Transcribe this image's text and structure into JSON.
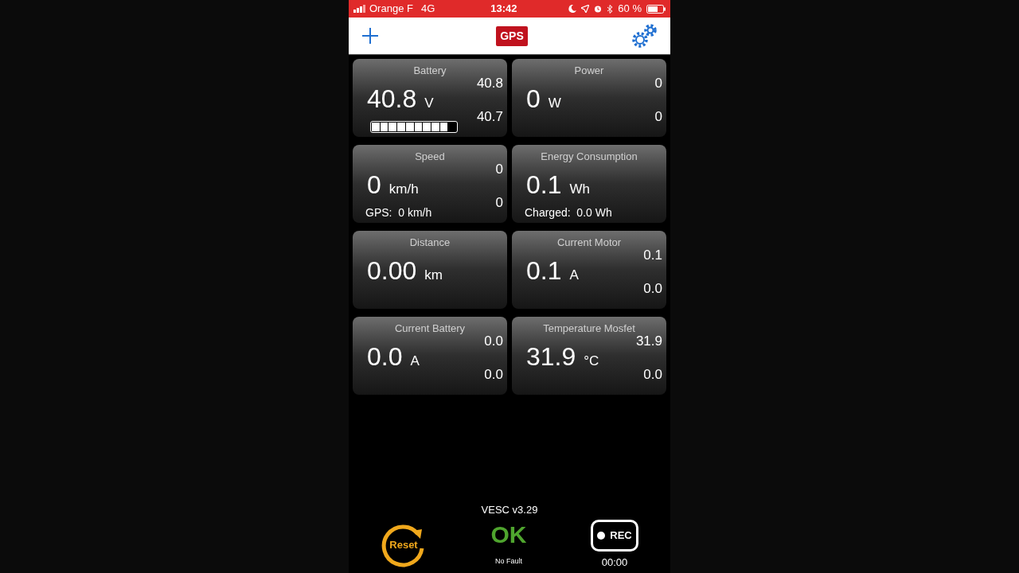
{
  "status_bar": {
    "carrier": "Orange F",
    "network": "4G",
    "time": "13:42",
    "battery": "60 %"
  },
  "header": {
    "badge": "GPS"
  },
  "cards": [
    {
      "kind": "battery",
      "title": "Battery",
      "value": "40.8",
      "unit": "V",
      "max": "40.8",
      "min": "40.7",
      "level": 0.9
    },
    {
      "kind": "plain",
      "title": "Power",
      "value": "0",
      "unit": "W",
      "max": "0",
      "min": "0"
    },
    {
      "kind": "footer",
      "title": "Speed",
      "value": "0",
      "unit": "km/h",
      "max": "0",
      "min": "0",
      "footer": "GPS:  0 km/h"
    },
    {
      "kind": "footer",
      "title": "Energy Consumption",
      "value": "0.1",
      "unit": "Wh",
      "footer": "Charged:  0.0 Wh"
    },
    {
      "kind": "plain",
      "title": "Distance",
      "value": "0.00",
      "unit": "km"
    },
    {
      "kind": "plain",
      "title": "Current Motor",
      "value": "0.1",
      "unit": "A",
      "max": "0.1",
      "min": "0.0"
    },
    {
      "kind": "plain",
      "title": "Current Battery",
      "value": "0.0",
      "unit": "A",
      "max": "0.0",
      "min": "0.0"
    },
    {
      "kind": "plain",
      "title": "Temperature Mosfet",
      "value": "31.9",
      "unit": "°C",
      "max": "31.9",
      "min": "0.0"
    }
  ],
  "footer": {
    "version": "VESC v3.29",
    "reset": "Reset",
    "status": "OK",
    "fault": "No Fault",
    "rec": "REC",
    "rec_time": "00:00"
  }
}
